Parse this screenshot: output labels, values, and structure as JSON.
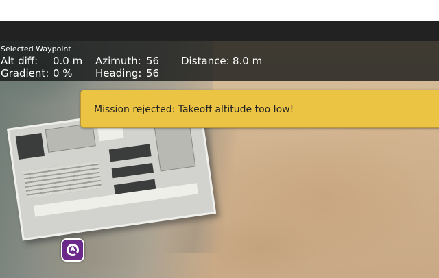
{
  "selected_waypoint": {
    "title": "Selected Waypoint",
    "alt_diff": {
      "label": "Alt diff:",
      "value": "0.0 m"
    },
    "gradient": {
      "label": "Gradient:",
      "value": "0 %"
    },
    "azimuth": {
      "label": "Azimuth:",
      "value": "56"
    },
    "heading": {
      "label": "Heading:",
      "value": "56"
    },
    "distance": {
      "label": "Distance:",
      "value": "8.0 m"
    }
  },
  "alert": {
    "message": "Mission rejected: Takeoff altitude too low!",
    "color": "#ecc443"
  },
  "vehicle": {
    "icon": "vehicle-icon",
    "color": "#6b2a8a"
  },
  "colors": {
    "toolbar": "#222222",
    "info_panel": "#121414"
  }
}
